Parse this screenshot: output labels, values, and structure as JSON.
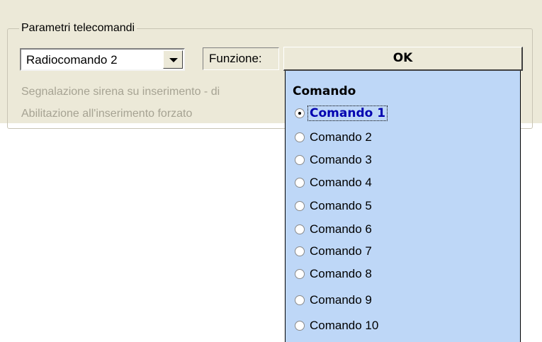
{
  "group": {
    "title": "Parametri telecomandi"
  },
  "combo": {
    "value": "Radiocomando 2"
  },
  "function_label": "Funzione:",
  "ok_button": "OK",
  "options_disabled": [
    "Segnalazione sirena su inserimento - di",
    "Abilitazione all'inserimento forzato"
  ],
  "dropdown": {
    "header": "Comando",
    "selected": "Comando 1",
    "items": [
      "Comando 1",
      "Comando 2",
      "Comando 3",
      "Comando 4",
      "Comando 5",
      "Comando 6",
      "Comando 7",
      "Comando 8",
      "Comando 9",
      "Comando 10"
    ]
  }
}
